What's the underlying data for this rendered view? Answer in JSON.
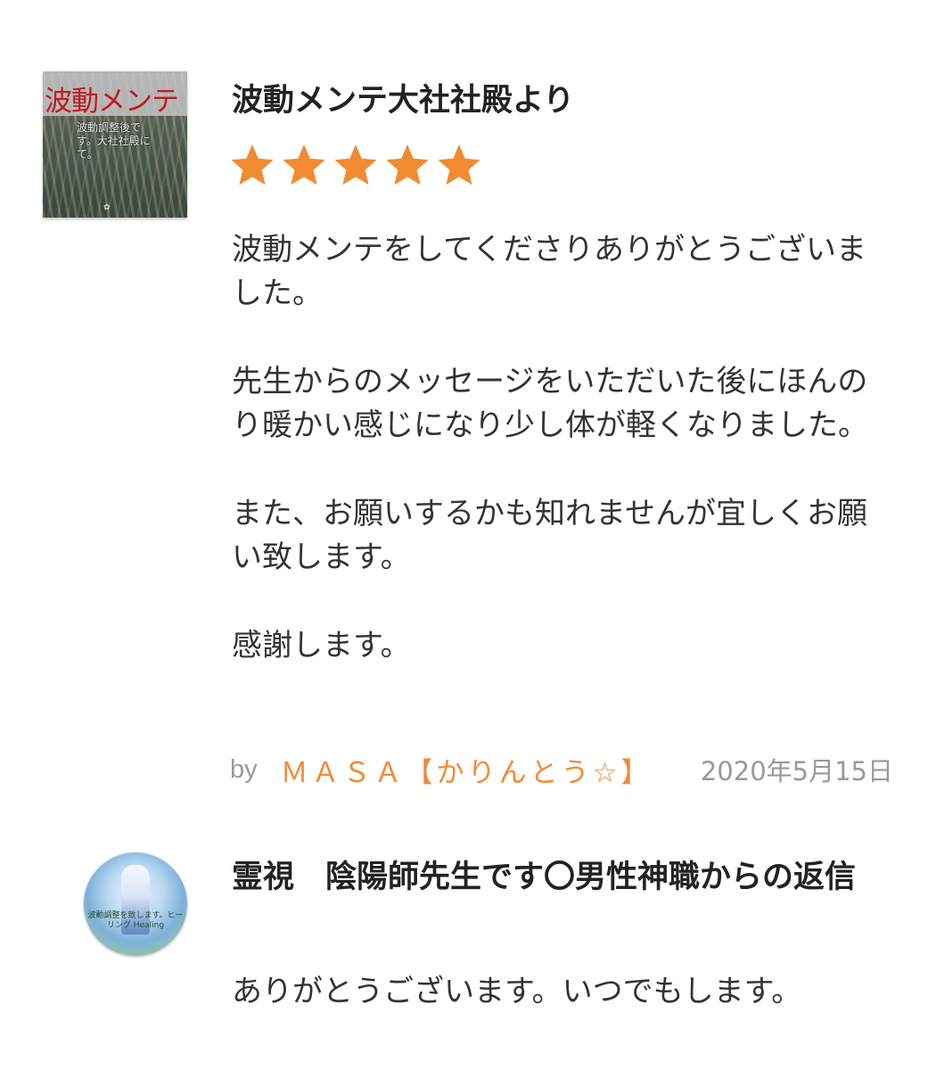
{
  "review": {
    "thumbnail": {
      "title": "波動メンテ",
      "subtitle": "波動調整後です。大社社殿にて。",
      "mark": "✿"
    },
    "title": "波動メンテ大社社殿より",
    "rating": 5,
    "rating_max": 5,
    "star_icon": "star-icon",
    "star_color": "#f28a30",
    "paragraphs": [
      "波動メンテをしてくださりありがとうございました。",
      "先生からのメッセージをいただいた後にほんのり暖かい感じになり少し体が軽くなりました。",
      "また、お願いするかも知れませんが宜しくお願い致します。",
      "感謝します。"
    ],
    "by_label": "by",
    "author": "ＭＡＳＡ【かりんとう☆】",
    "author_color": "#ef8b3a",
    "date": "2020年5月15日"
  },
  "reply": {
    "avatar_text": "波動調整を致します。ヒーリング Healing",
    "title": "霊視　陰陽師先生です〇男性神職からの返信",
    "body": "ありがとうございます。いつでもします。"
  }
}
